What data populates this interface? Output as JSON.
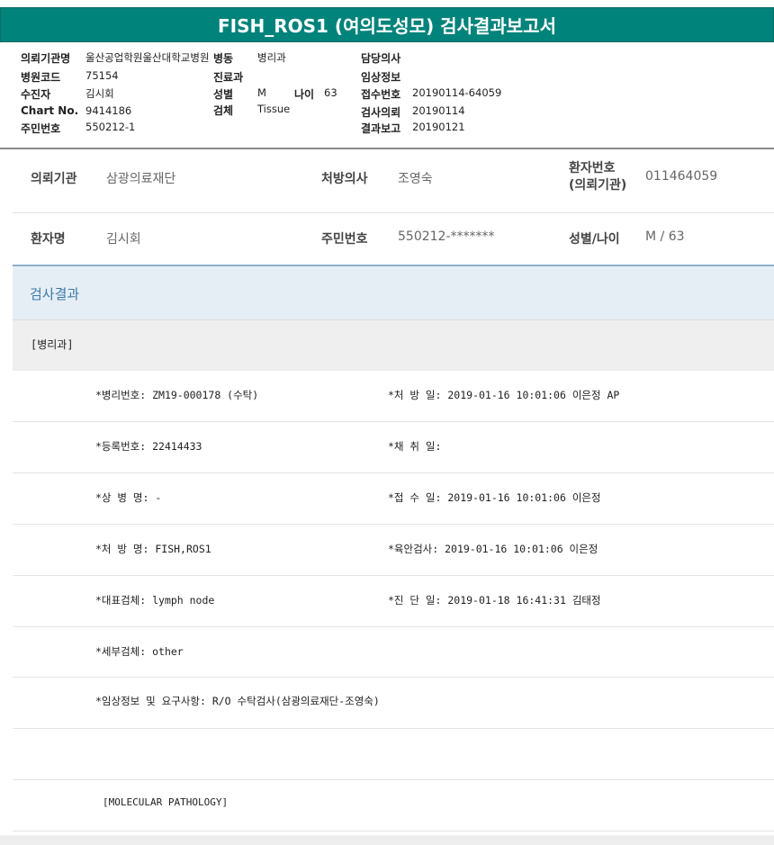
{
  "title": "FISH_ROS1 (여의도성모) 검사결과보고서",
  "header": {
    "col1": [
      {
        "label": "의뢰기관명",
        "value": "울산공업학원울산대학교병원"
      },
      {
        "label": "병원코드",
        "value": "75154"
      },
      {
        "label": "수진자",
        "value": "김시회"
      },
      {
        "label": "Chart No.",
        "value": "9414186"
      },
      {
        "label": "주민번호",
        "value": "550212-1"
      }
    ],
    "col2": [
      {
        "label": "병동",
        "value": "병리과"
      },
      {
        "label": "진료과",
        "value": ""
      },
      {
        "label": "성별",
        "value": "M"
      },
      {
        "label": "검체",
        "value": "Tissue"
      }
    ],
    "age": {
      "label": "나이",
      "value": "63"
    },
    "col3": [
      {
        "label": "담당의사",
        "value": ""
      },
      {
        "label": "임상정보",
        "value": ""
      },
      {
        "label": "접수번호",
        "value": "20190114-64059"
      },
      {
        "label": "검사의뢰",
        "value": "20190114"
      },
      {
        "label": "결과보고",
        "value": "20190121"
      }
    ]
  },
  "info": {
    "row1": {
      "org_label": "의뢰기관",
      "org_value": "삼광의료재단",
      "doctor_label": "처방의사",
      "doctor_value": "조영숙",
      "pid_label_1": "환자번호",
      "pid_label_2": "(의뢰기관)",
      "pid_value": "011464059"
    },
    "row2": {
      "name_label": "환자명",
      "name_value": "김시회",
      "rrn_label": "주민번호",
      "rrn_value": "550212-*******",
      "sexage_label": "성별/나이",
      "sexage_value": "M / 63"
    }
  },
  "results": {
    "section_title": "검사결과",
    "dept": "[병리과]",
    "rows": [
      {
        "left": "*병리번호: ZM19-000178 (수탁)",
        "right": "*처 방 일: 2019-01-16 10:01:06  이은정 AP"
      },
      {
        "left": "*등록번호: 22414433",
        "right": "*채 취 일:"
      },
      {
        "left": "*상 병 명: -",
        "right": "*접 수 일: 2019-01-16 10:01:06  이은정"
      },
      {
        "left": "*처 방 명: FISH,ROS1",
        "right": "*육안검사: 2019-01-16 10:01:06  이은정"
      },
      {
        "left": "*대표검체: lymph node",
        "right": "*진 단 일: 2019-01-18 16:41:31  김태정"
      },
      {
        "left": "*세부검체: other",
        "right": ""
      },
      {
        "left": "*임상정보 및 요구사항: R/O 수탁검사(삼광의료재단-조영숙)",
        "right": ""
      },
      {
        "left": "",
        "right": ""
      },
      {
        "left": "[MOLECULAR PATHOLOGY]",
        "right": ""
      }
    ]
  }
}
